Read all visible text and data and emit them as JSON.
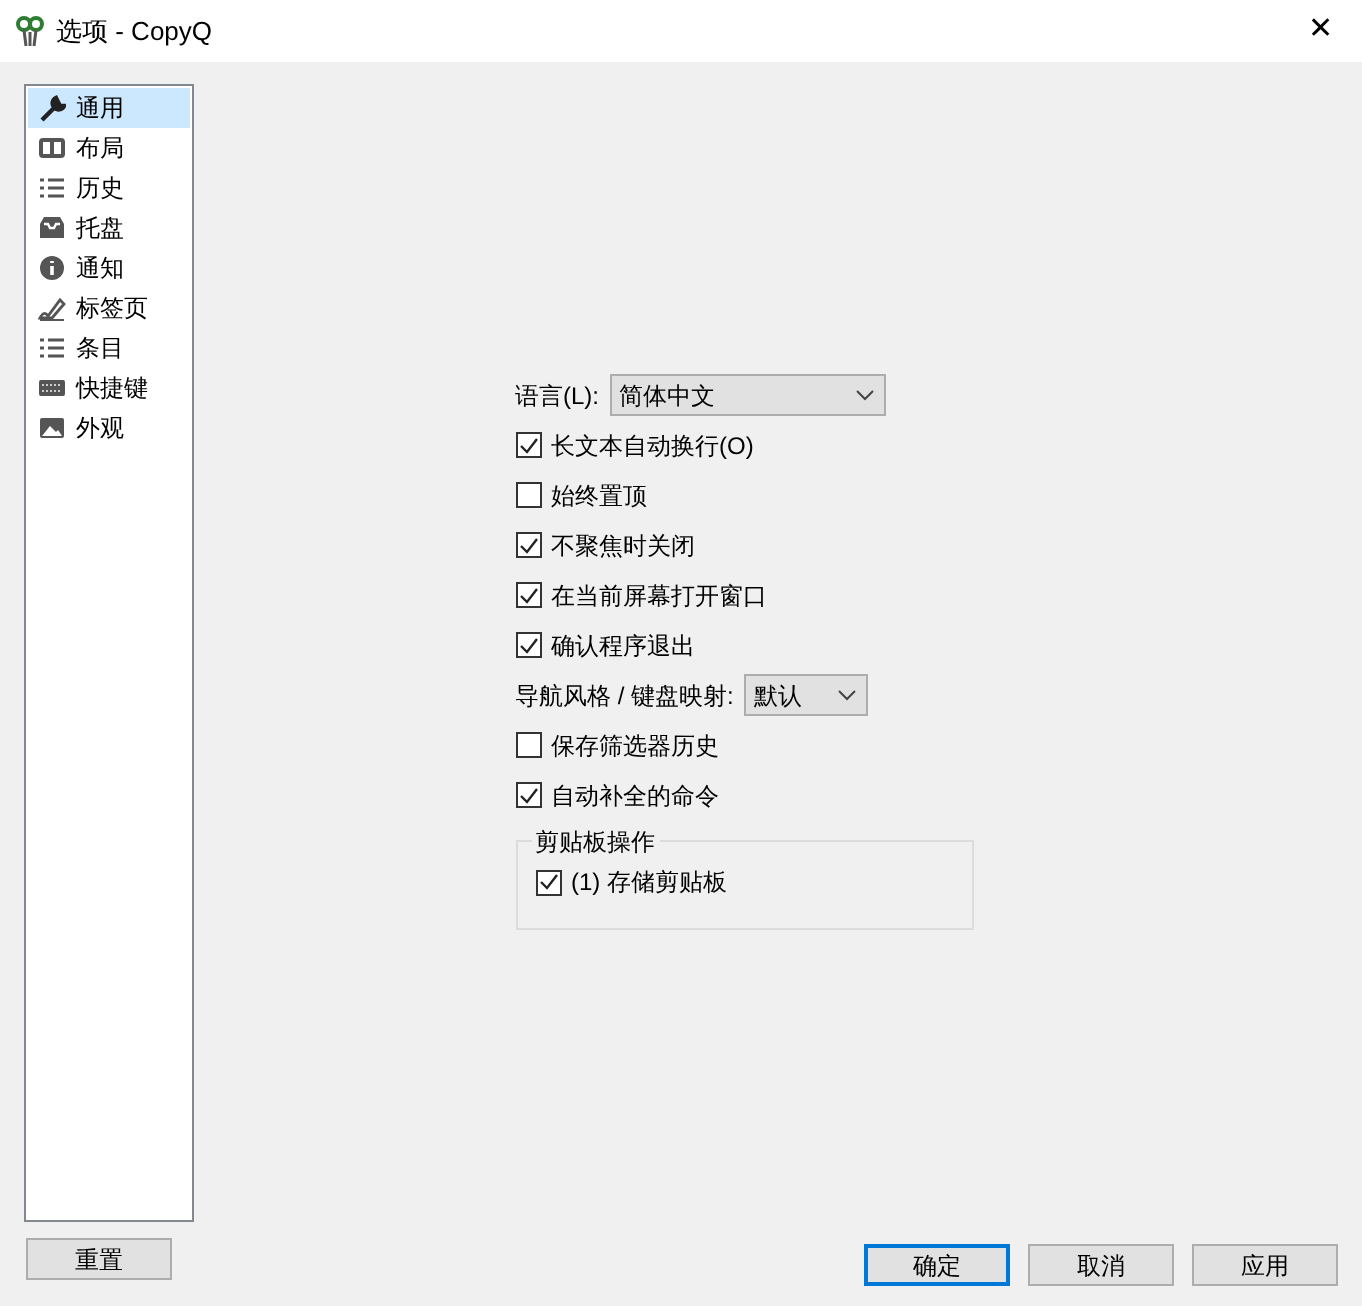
{
  "window": {
    "title": "选项 - CopyQ",
    "close": "✕"
  },
  "sidebar": {
    "items": [
      {
        "label": "通用",
        "kind": "wrench",
        "selected": true
      },
      {
        "label": "布局",
        "kind": "layout",
        "selected": false
      },
      {
        "label": "历史",
        "kind": "list",
        "selected": false
      },
      {
        "label": "托盘",
        "kind": "tray",
        "selected": false
      },
      {
        "label": "通知",
        "kind": "info",
        "selected": false
      },
      {
        "label": "标签页",
        "kind": "pen",
        "selected": false
      },
      {
        "label": "条目",
        "kind": "list",
        "selected": false
      },
      {
        "label": "快捷键",
        "kind": "keyboard",
        "selected": false
      },
      {
        "label": "外观",
        "kind": "image",
        "selected": false
      }
    ]
  },
  "form": [
    {
      "kind": "combo",
      "label": "语言(L):",
      "value": "简体中文"
    },
    {
      "kind": "checkbox",
      "label": "长文本自动换行(O)",
      "checked": true
    },
    {
      "kind": "checkbox",
      "label": "始终置顶",
      "checked": false
    },
    {
      "kind": "checkbox",
      "label": "不聚焦时关闭",
      "checked": true
    },
    {
      "kind": "checkbox",
      "label": "在当前屏幕打开窗口",
      "checked": true
    },
    {
      "kind": "checkbox",
      "label": "确认程序退出",
      "checked": true
    },
    {
      "kind": "combo",
      "label": "导航风格 / 键盘映射:",
      "value": "默认"
    },
    {
      "kind": "checkbox",
      "label": "保存筛选器历史",
      "checked": false
    },
    {
      "kind": "checkbox",
      "label": "自动补全的命令",
      "checked": true
    },
    {
      "kind": "group",
      "title": "剪贴板操作",
      "items": [
        {
          "label": "(1) 存储剪贴板",
          "checked": true
        }
      ]
    }
  ],
  "buttons": {
    "reset": "重置",
    "actions": [
      {
        "label": "确定",
        "focused": true
      },
      {
        "label": "取消",
        "focused": false
      },
      {
        "label": "应用",
        "focused": false
      }
    ]
  }
}
